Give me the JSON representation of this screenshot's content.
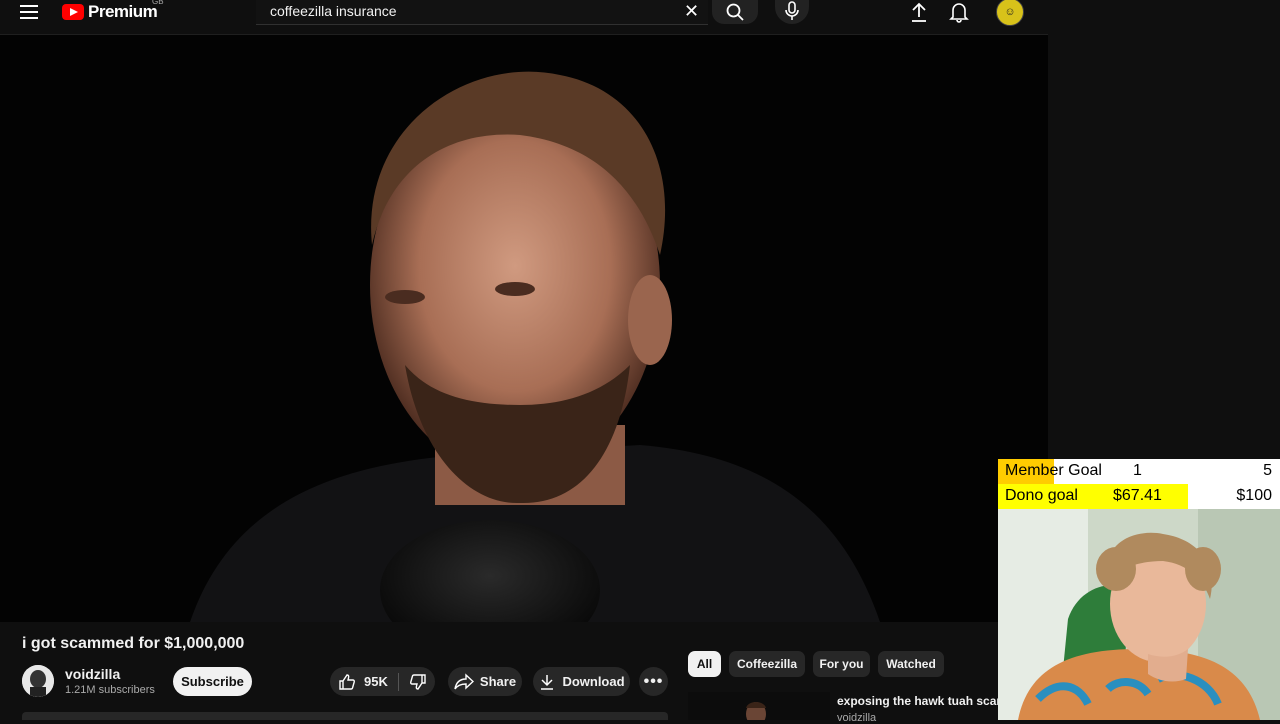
{
  "header": {
    "brand": "Premium",
    "country_code": "GB",
    "search_value": "coffeezilla insurance",
    "search_placeholder": "Search"
  },
  "video": {
    "title": "i got scammed for $1,000,000",
    "channel": {
      "name": "voidzilla",
      "subscribers": "1.21M subscribers"
    },
    "subscribe_label": "Subscribe",
    "likes": "95K",
    "share_label": "Share",
    "download_label": "Download",
    "more_label": "•••"
  },
  "chips": [
    {
      "label": "All",
      "active": true
    },
    {
      "label": "Coffeezilla",
      "active": false
    },
    {
      "label": "For you",
      "active": false
    },
    {
      "label": "Watched",
      "active": false
    }
  ],
  "recommendation": {
    "title": "exposing the hawk tuah scam",
    "channel": "voidzilla"
  },
  "stream_overlay": {
    "member_goal": {
      "label": "Member Goal",
      "current": "1",
      "target": "5",
      "progress": 0.2
    },
    "dono_goal": {
      "label": "Dono goal",
      "current": "$67.41",
      "target": "$100",
      "progress": 0.674
    }
  },
  "colors": {
    "background": "#0f0f0f",
    "brand_red": "#ff0000",
    "member_goal_fill": "#ffcc00",
    "dono_goal_fill": "#ffff00"
  }
}
